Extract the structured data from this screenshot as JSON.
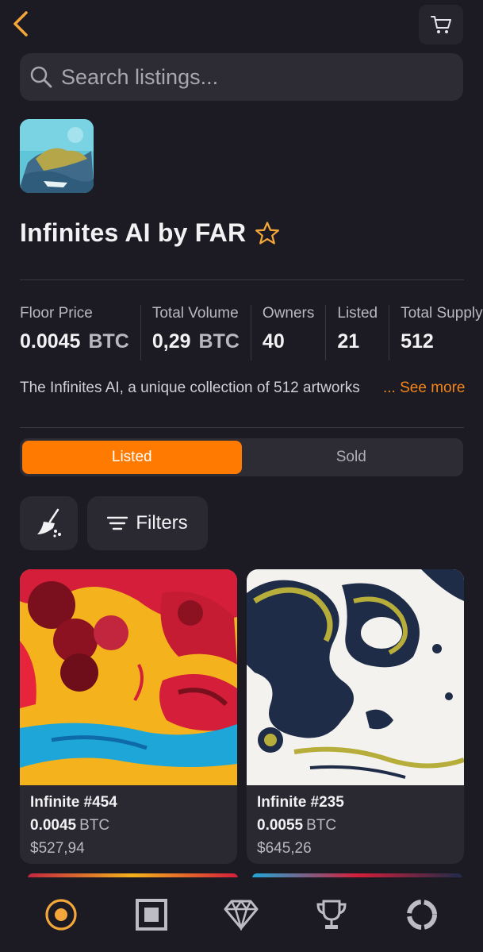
{
  "search": {
    "placeholder": "Search listings..."
  },
  "collection": {
    "name": "Infinites AI by FAR",
    "description": "The Infinites AI, a unique collection of 512 artworks",
    "see_more": "... See more"
  },
  "stats": [
    {
      "label": "Floor Price",
      "value": "0.0045",
      "unit": "BTC"
    },
    {
      "label": "Total Volume",
      "value": "0,29",
      "unit": "BTC"
    },
    {
      "label": "Owners",
      "value": "40"
    },
    {
      "label": "Listed",
      "value": "21"
    },
    {
      "label": "Total Supply",
      "value": "512"
    }
  ],
  "tabs": {
    "listed": "Listed",
    "sold": "Sold",
    "active": "listed"
  },
  "toolbar": {
    "filters_label": "Filters"
  },
  "listings": [
    {
      "name": "Infinite #454",
      "price": "0.0045",
      "unit": "BTC",
      "usd": "$527,94"
    },
    {
      "name": "Infinite #235",
      "price": "0.0055",
      "unit": "BTC",
      "usd": "$645,26"
    }
  ],
  "colors": {
    "accent": "#ff7a00",
    "background": "#1c1a22",
    "surface": "#2a2830"
  },
  "icons": {
    "back": "chevron-left-icon",
    "cart": "cart-icon",
    "search": "search-icon",
    "favorite": "star-outline-icon",
    "clear": "broom-icon",
    "filters": "filter-lines-icon",
    "nav": [
      "ordinals-icon",
      "square-frame-icon",
      "diamond-icon",
      "trophy-icon",
      "ring-icon"
    ]
  }
}
